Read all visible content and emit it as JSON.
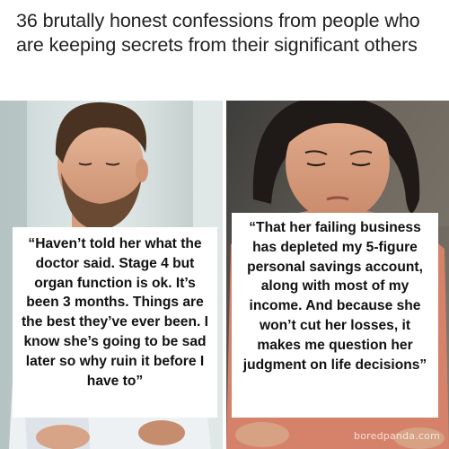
{
  "headline": "36 brutally honest confessions from people who are keeping secrets from their significant others",
  "left_panel": {
    "quote": "“Haven’t told her what the doctor said. Stage 4 but organ function is ok. It’s been 3 months. Things are the best they’ve ever been. I know she’s going to be sad later so why ruin it before I have to”"
  },
  "right_panel": {
    "quote": "“That her failing business has depleted my 5-figure personal savings account, along with most of my income. And because she won’t cut her losses, it makes me question her judgment on life decisions”"
  },
  "watermark": "boredpanda.com",
  "colors": {
    "headline_text": "#222222",
    "quote_text": "#111111",
    "card_background": "#ffffff"
  }
}
